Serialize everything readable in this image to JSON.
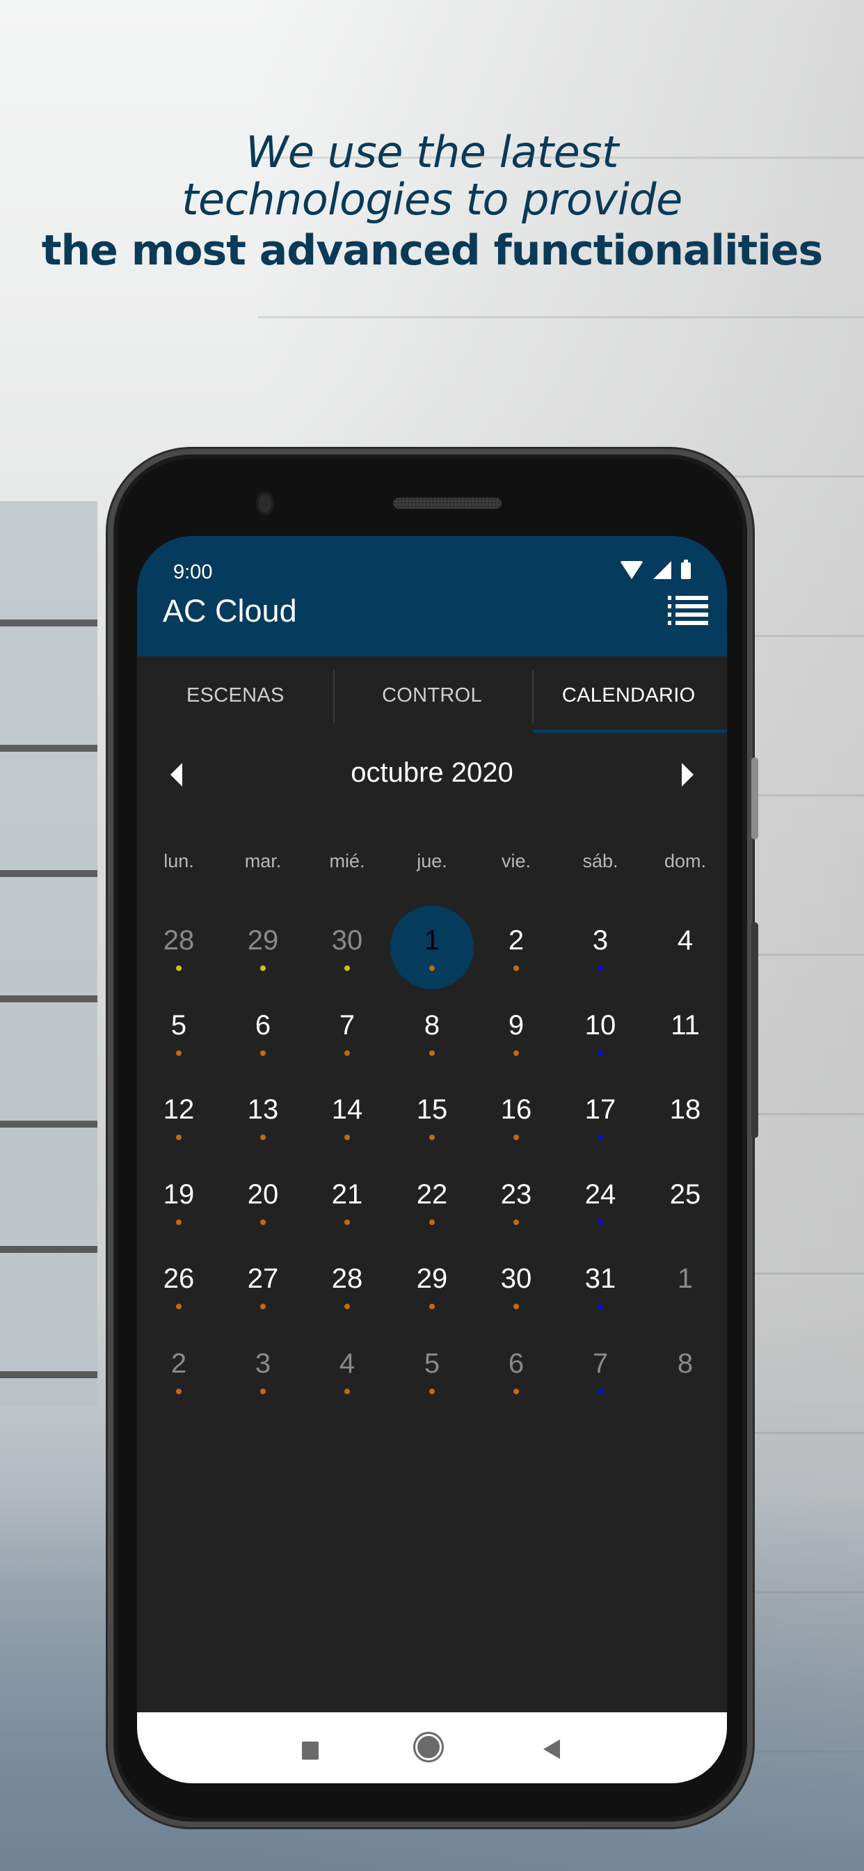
{
  "headline": {
    "line1": "We use the latest",
    "line2": "technologies to provide",
    "line3": "the most advanced functionalities"
  },
  "status_bar": {
    "time": "9:00",
    "icons": [
      "wifi-icon",
      "signal-icon",
      "battery-icon"
    ]
  },
  "app_bar": {
    "title": "AC Cloud",
    "menu_icon": "list-menu-icon"
  },
  "tabs": [
    {
      "label": "ESCENAS",
      "active": false
    },
    {
      "label": "CONTROL",
      "active": false
    },
    {
      "label": "CALENDARIO",
      "active": true
    }
  ],
  "calendar": {
    "month_label": "octubre 2020",
    "prev_icon": "caret-left-icon",
    "next_icon": "caret-right-icon",
    "weekdays": [
      "lun.",
      "mar.",
      "mié.",
      "jue.",
      "vie.",
      "sáb.",
      "dom."
    ],
    "dot_colors": {
      "yellow": "#c8c21a",
      "orange": "#c46a12",
      "blue": "#0a12c8"
    },
    "selected_color": "#053b5d",
    "weeks": [
      [
        {
          "d": "28",
          "other": true,
          "dot": "yellow"
        },
        {
          "d": "29",
          "other": true,
          "dot": "yellow"
        },
        {
          "d": "30",
          "other": true,
          "dot": "yellow"
        },
        {
          "d": "1",
          "selected": true,
          "dot": "orange"
        },
        {
          "d": "2",
          "dot": "orange"
        },
        {
          "d": "3",
          "dot": "blue"
        },
        {
          "d": "4"
        }
      ],
      [
        {
          "d": "5",
          "dot": "orange"
        },
        {
          "d": "6",
          "dot": "orange"
        },
        {
          "d": "7",
          "dot": "orange"
        },
        {
          "d": "8",
          "dot": "orange"
        },
        {
          "d": "9",
          "dot": "orange"
        },
        {
          "d": "10",
          "dot": "blue"
        },
        {
          "d": "11"
        }
      ],
      [
        {
          "d": "12",
          "dot": "orange"
        },
        {
          "d": "13",
          "dot": "orange"
        },
        {
          "d": "14",
          "dot": "orange"
        },
        {
          "d": "15",
          "dot": "orange"
        },
        {
          "d": "16",
          "dot": "orange"
        },
        {
          "d": "17",
          "dot": "blue"
        },
        {
          "d": "18"
        }
      ],
      [
        {
          "d": "19",
          "dot": "orange"
        },
        {
          "d": "20",
          "dot": "orange"
        },
        {
          "d": "21",
          "dot": "orange"
        },
        {
          "d": "22",
          "dot": "orange"
        },
        {
          "d": "23",
          "dot": "orange"
        },
        {
          "d": "24",
          "dot": "blue"
        },
        {
          "d": "25"
        }
      ],
      [
        {
          "d": "26",
          "dot": "orange"
        },
        {
          "d": "27",
          "dot": "orange"
        },
        {
          "d": "28",
          "dot": "orange"
        },
        {
          "d": "29",
          "dot": "orange"
        },
        {
          "d": "30",
          "dot": "orange"
        },
        {
          "d": "31",
          "dot": "blue"
        },
        {
          "d": "1",
          "other": true
        }
      ],
      [
        {
          "d": "2",
          "other": true,
          "dot": "orange"
        },
        {
          "d": "3",
          "other": true,
          "dot": "orange"
        },
        {
          "d": "4",
          "other": true,
          "dot": "orange"
        },
        {
          "d": "5",
          "other": true,
          "dot": "orange"
        },
        {
          "d": "6",
          "other": true,
          "dot": "orange"
        },
        {
          "d": "7",
          "other": true,
          "dot": "blue"
        },
        {
          "d": "8",
          "other": true
        }
      ]
    ]
  },
  "nav_bar": {
    "icons": [
      "recents-square-icon",
      "home-circle-icon",
      "back-triangle-icon"
    ]
  },
  "colors": {
    "brand": "#053b5d",
    "headline_text": "#0a3a57",
    "screen_bg": "#222222"
  }
}
